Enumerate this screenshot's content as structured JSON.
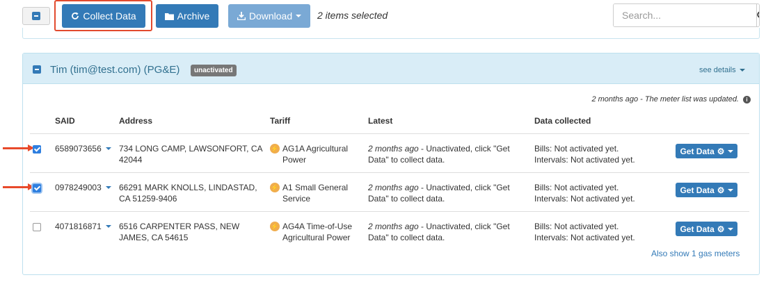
{
  "toolbar": {
    "collect_label": "Collect Data",
    "archive_label": "Archive",
    "download_label": "Download",
    "selection_status": "2 items selected",
    "search_placeholder": "Search..."
  },
  "account": {
    "title": "Tim (tim@test.com) (PG&E)",
    "status_badge": "unactivated",
    "see_details": "see details",
    "meter_note": "2 months ago - The meter list was updated."
  },
  "table": {
    "headers": [
      "SAID",
      "Address",
      "Tariff",
      "Latest",
      "Data collected"
    ],
    "rows": [
      {
        "checked": true,
        "said": "6589073656",
        "address": [
          "734 LONG CAMP, LAWSONFORT, CA",
          "42044"
        ],
        "tariff": [
          "AG1A Agricultural",
          "Power"
        ],
        "latest_time": "2 months ago",
        "latest": [
          " - Unactivated, click \"Get",
          "Data\" to collect data."
        ],
        "data_collected": [
          "Bills: Not activated yet.",
          "Intervals: Not activated yet."
        ],
        "action": "Get Data"
      },
      {
        "checked": true,
        "said": "0978249003",
        "address": [
          "66291 MARK KNOLLS, LINDASTAD,",
          "CA 51259-9406"
        ],
        "tariff": [
          "A1 Small General",
          "Service"
        ],
        "latest_time": "2 months ago",
        "latest": [
          " - Unactivated, click \"Get",
          "Data\" to collect data."
        ],
        "data_collected": [
          "Bills: Not activated yet.",
          "Intervals: Not activated yet."
        ],
        "action": "Get Data"
      },
      {
        "checked": false,
        "said": "4071816871",
        "address": [
          "6516 CARPENTER PASS, NEW",
          "JAMES, CA 54615"
        ],
        "tariff": [
          "AG4A Time-of-Use",
          "Agricultural Power"
        ],
        "latest_time": "2 months ago",
        "latest": [
          " - Unactivated, click \"Get",
          "Data\" to collect data."
        ],
        "data_collected": [
          "Bills: Not activated yet.",
          "Intervals: Not activated yet."
        ],
        "action": "Get Data"
      }
    ],
    "gas_link": "Also show 1 gas meters"
  },
  "icons": {
    "collect": "refresh-icon",
    "archive": "folder-icon",
    "download": "download-icon",
    "search": "search-icon",
    "tariff": "lightning-bolt-icon",
    "action": "gear-icon",
    "info": "info-icon"
  },
  "colors": {
    "primary": "#337ab7",
    "panel_heading": "#d9edf7",
    "panel_text": "#31708f",
    "annotation": "#e84a2b",
    "bolt": "#f0ad4e",
    "badge": "#777777"
  }
}
